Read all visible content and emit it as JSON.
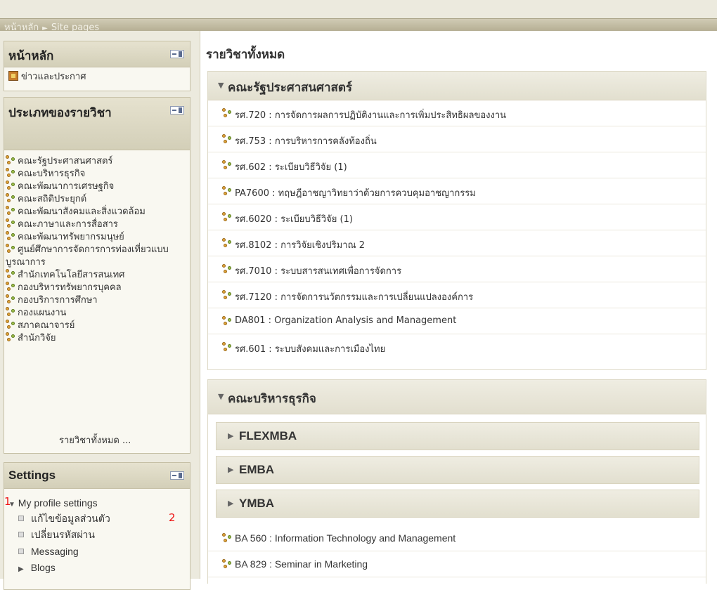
{
  "breadcrumb": {
    "home": "หน้าหลัก",
    "separator": "►",
    "current": "Site pages"
  },
  "blocks": {
    "main_menu": {
      "title": "หน้าหลัก",
      "items": [
        {
          "label": "ข่าวและประกาศ",
          "icon": "news-icon"
        }
      ]
    },
    "categories": {
      "title": "ประเภทของรายวิชา",
      "items": [
        "คณะรัฐประศาสนศาสตร์",
        "คณะบริหารธุรกิจ",
        "คณะพัฒนาการเศรษฐกิจ",
        "คณะสถิติประยุกต์",
        "คณะพัฒนาสังคมและสิ่งแวดล้อม",
        "คณะภาษาและการสื่อสาร",
        "คณะพัฒนาทรัพยากรมนุษย์",
        "ศูนย์ศึกษาการจัดการการท่องเที่ยวแบบบูรณาการ",
        "สำนักเทคโนโลยีสารสนเทศ",
        "กองบริหารทรัพยากรบุคคล",
        "กองบริการการศึกษา",
        "กองแผนงาน",
        "สภาคณาจารย์",
        "สำนักวิจัย"
      ],
      "all_courses_link": "รายวิชาทั้งหมด ..."
    },
    "settings": {
      "title": "Settings",
      "profile_settings": "My profile settings",
      "sub_items": [
        "แก้ไขข้อมูลส่วนตัว",
        "เปลี่ยนรหัสผ่าน",
        "Messaging",
        "Blogs"
      ],
      "annotations": [
        "1",
        "2"
      ]
    }
  },
  "main": {
    "title": "รายวิชาทั้งหมด",
    "categories": [
      {
        "name": "คณะรัฐประศาสนศาสตร์",
        "courses": [
          "รศ.720 : การจัดการผลการปฏิบัติงานและการเพิ่มประสิทธิผลของงาน",
          "รศ.753 : การบริหารการคลังท้องถิ่น",
          "รศ.602 : ระเบียบวิธีวิจัย (1)",
          "PA7600 : ทฤษฎีอาชญาวิทยาว่าด้วยการควบคุมอาชญากรรม",
          "รศ.6020 : ระเบียบวิธีวิจัย (1)",
          "รศ.8102 : การวิจัยเชิงปริมาณ 2",
          "รศ.7010 : ระบบสารสนเทศเพื่อการจัดการ",
          "รศ.7120 : การจัดการนวัตกรรมและการเปลี่ยนแปลงองค์การ",
          "DA801 : Organization Analysis and Management",
          "รศ.601 : ระบบสังคมและการเมืองไทย"
        ]
      },
      {
        "name": "คณะบริหารธุรกิจ",
        "subcategories": [
          "FLEXMBA",
          "EMBA",
          "YMBA"
        ],
        "courses": [
          "BA 560 : Information Technology and Management",
          "BA 829 : Seminar in Marketing"
        ]
      }
    ]
  }
}
